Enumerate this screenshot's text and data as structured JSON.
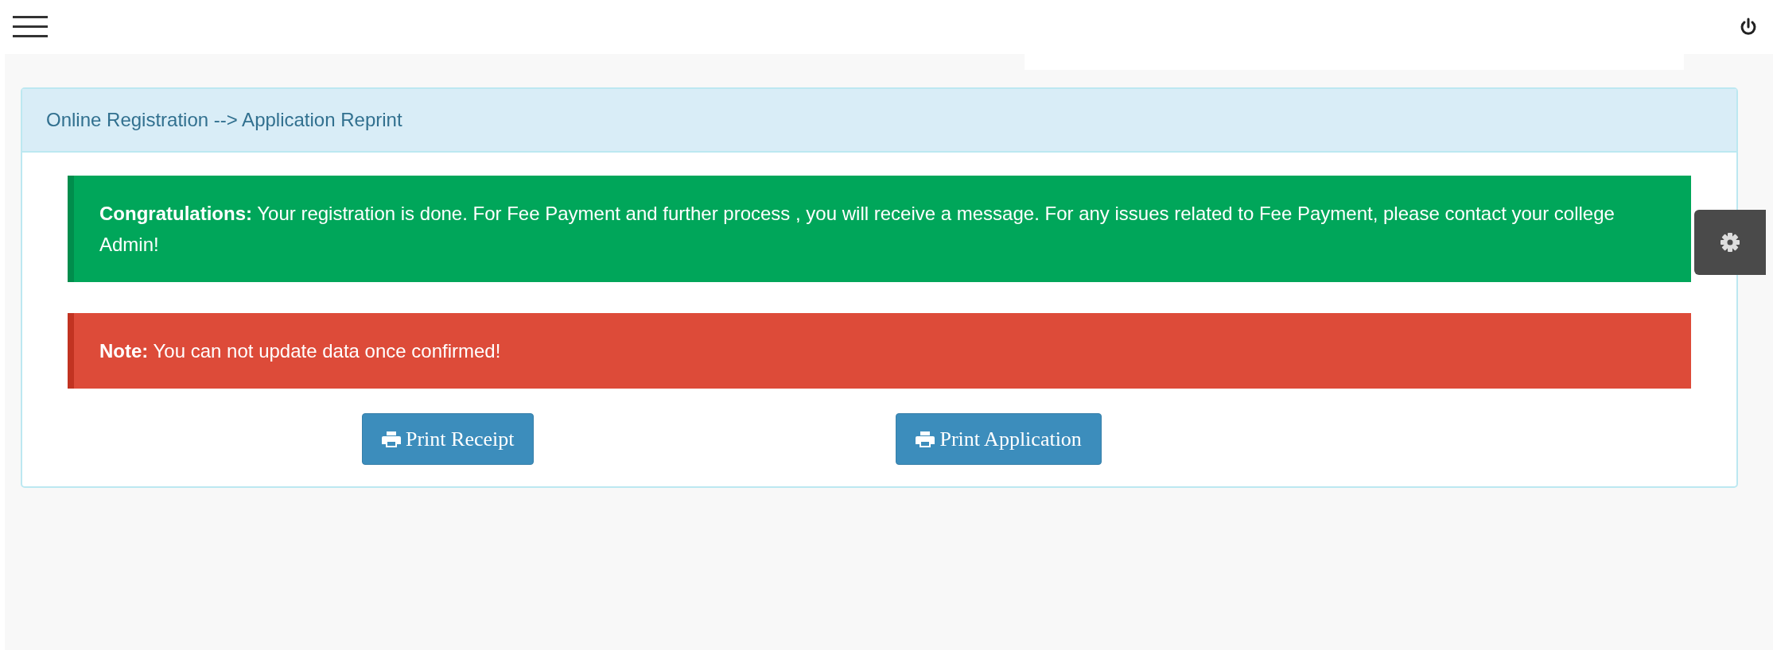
{
  "panel": {
    "title": "Online Registration --> Application Reprint"
  },
  "alerts": [
    {
      "kind": "success",
      "text": "**Congratulations:** Your registration is done. For Fee Payment and further process , you will receive a message. For any issues related to Fee Payment, please contact your college Admin!"
    },
    {
      "kind": "danger",
      "text": "**Note:** You can not update data once confirmed!"
    }
  ],
  "buttons": [
    {
      "label": "Print Receipt"
    },
    {
      "label": "Print Application"
    }
  ]
}
